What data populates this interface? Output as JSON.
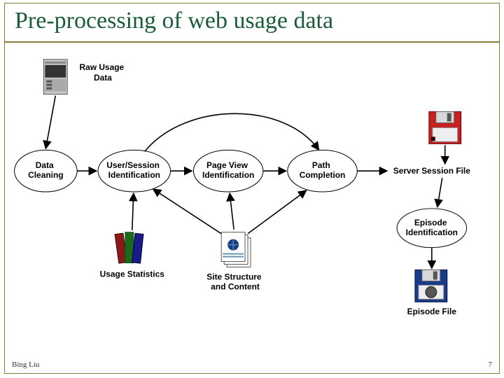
{
  "title": "Pre-processing of web usage data",
  "footer": {
    "author": "Bing Liu",
    "page": "7"
  },
  "nodes": {
    "raw_usage": "Raw Usage\nData",
    "data_cleaning": "Data\nCleaning",
    "user_session": "User/Session\nIdentification",
    "page_view": "Page View\nIdentification",
    "path_completion": "Path\nCompletion",
    "server_session_file": "Server Session File",
    "episode_identification": "Episode\nIdentification",
    "episode_file": "Episode File",
    "usage_statistics": "Usage Statistics",
    "site_structure": "Site Structure\nand Content"
  },
  "icons": {
    "server": "server-icon",
    "books": "books-icon",
    "document": "document-stack-icon",
    "floppy_red": "red-floppy-icon",
    "floppy_blue": "blue-floppy-icon"
  }
}
